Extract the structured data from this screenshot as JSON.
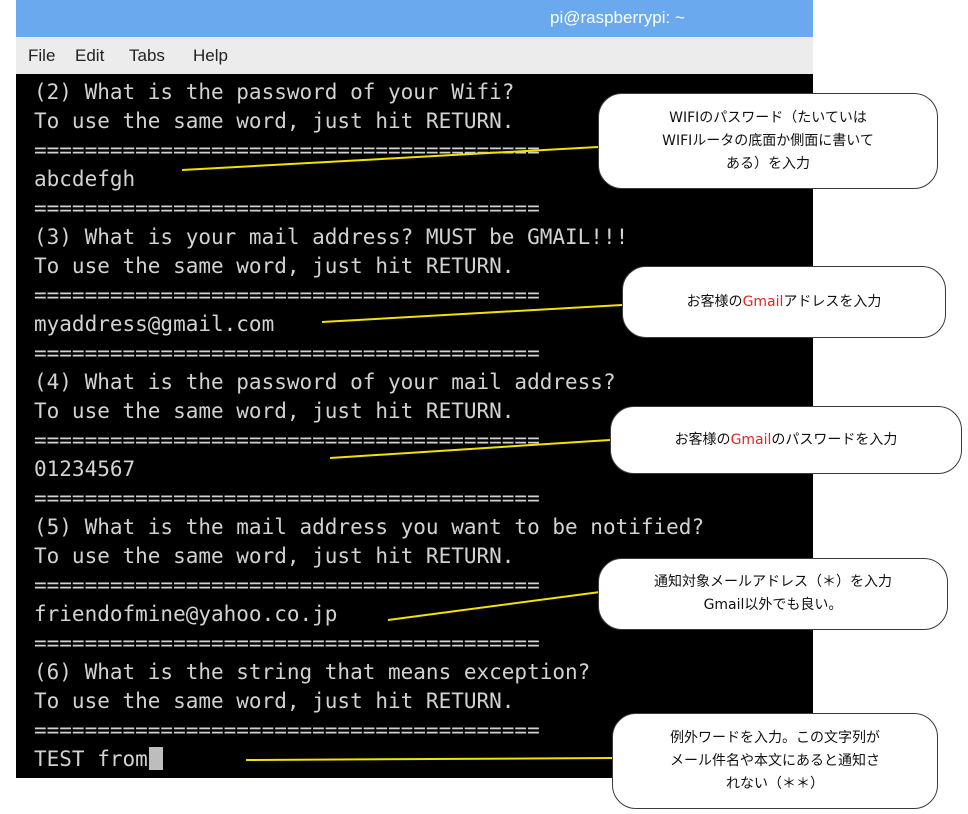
{
  "window": {
    "title": "pi@raspberrypi: ~",
    "menu": [
      "File",
      "Edit",
      "Tabs",
      "Help"
    ]
  },
  "terminal": {
    "lines": [
      "(2) What is the password of your Wifi?",
      "To use the same word, just hit RETURN.",
      "========================================",
      "abcdefgh",
      "========================================",
      "(3) What is your mail address? MUST be GMAIL!!!",
      "To use the same word, just hit RETURN.",
      "========================================",
      "myaddress@gmail.com",
      "========================================",
      "(4) What is the password of your mail address?",
      "To use the same word, just hit RETURN.",
      "========================================",
      "01234567",
      "========================================",
      "(5) What is the mail address you want to be notified?",
      "To use the same word, just hit RETURN.",
      "========================================",
      "friendofmine@yahoo.co.jp",
      "========================================",
      "(6) What is the string that means exception?",
      "To use the same word, just hit RETURN.",
      "========================================",
      "TEST from"
    ]
  },
  "callouts": {
    "wifi": {
      "line1": "WIFIのパスワード（たいていは",
      "line2": "WIFIルータの底面か側面に書いて",
      "line3": "ある）を入力"
    },
    "gmail_address": {
      "pre": "お客様の",
      "red": "Gmail",
      "post": "アドレスを入力"
    },
    "gmail_password": {
      "pre": "お客様の",
      "red": "Gmail",
      "post": "のパスワードを入力"
    },
    "notify": {
      "line1": "通知対象メールアドレス（＊）を入力",
      "line2": "Gmail以外でも良い。"
    },
    "exception": {
      "line1": "例外ワードを入力。この文字列が",
      "line2": "メール件名や本文にあると通知さ",
      "line3": "れない（＊＊）"
    }
  },
  "colors": {
    "titlebar": "#6aa9ee",
    "terminal_bg": "#000000",
    "terminal_text": "#d2d2d2",
    "arrow": "#f2e200",
    "accent_red": "#e0281e"
  }
}
